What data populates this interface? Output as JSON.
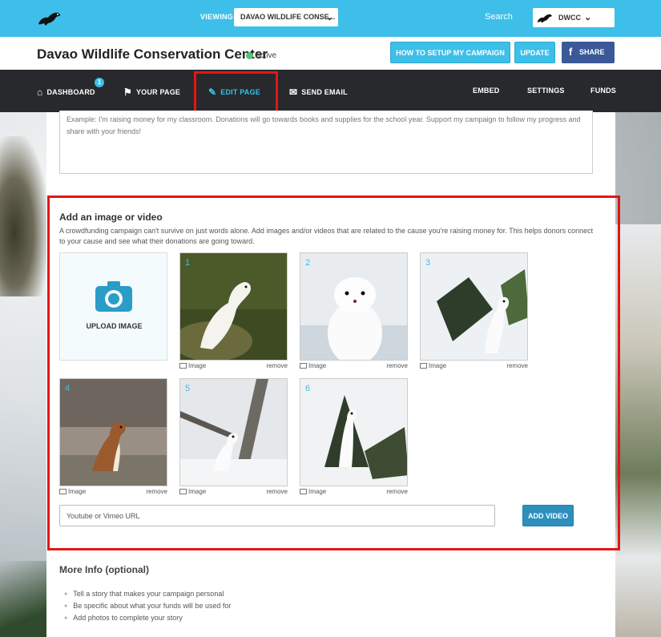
{
  "topbar": {
    "viewing_label": "VIEWING",
    "viewing_value": "DAVAO WILDLIFE CONSE...",
    "search_label": "Search",
    "user_name": "DWCC"
  },
  "header": {
    "title": "Davao Wildlife Conservation Center",
    "status": "active",
    "howto_label": "HOW TO SETUP MY CAMPAIGN",
    "update_label": "UPDATE",
    "share_label": "SHARE"
  },
  "nav": {
    "dashboard": "DASHBOARD",
    "dashboard_badge": "1",
    "your_page": "YOUR PAGE",
    "edit_page": "EDIT PAGE",
    "send_email": "SEND EMAIL",
    "embed": "EMBED",
    "settings": "SETTINGS",
    "funds": "FUNDS"
  },
  "description_placeholder": "Example: I'm raising money for my classroom. Donations will go towards books and supplies for the school year. Support my campaign to follow my progress and share with your friends!",
  "media": {
    "title": "Add an image or video",
    "description": "A crowdfunding campaign can't survive on just words alone. Add images and/or videos that are related to the cause you're raising money for. This helps donors connect to your cause and see what their donations are going toward.",
    "upload_label": "UPLOAD IMAGE",
    "images": [
      {
        "num": "1",
        "caption": "Image",
        "remove": "remove"
      },
      {
        "num": "2",
        "caption": "Image",
        "remove": "remove"
      },
      {
        "num": "3",
        "caption": "Image",
        "remove": "remove"
      },
      {
        "num": "4",
        "caption": "Image",
        "remove": "remove"
      },
      {
        "num": "5",
        "caption": "Image",
        "remove": "remove"
      },
      {
        "num": "6",
        "caption": "Image",
        "remove": "remove"
      }
    ],
    "video_placeholder": "Youtube or Vimeo URL",
    "add_video_label": "ADD VIDEO"
  },
  "more_info": {
    "title": "More Info (optional)",
    "tips": [
      "Tell a story that makes your campaign personal",
      "Be specific about what your funds will be used for",
      "Add photos to complete your story"
    ]
  },
  "colors": {
    "brand": "#3dbfe9",
    "nav_bg": "#27292c",
    "highlight": "#e01616",
    "facebook": "#3b5998"
  }
}
